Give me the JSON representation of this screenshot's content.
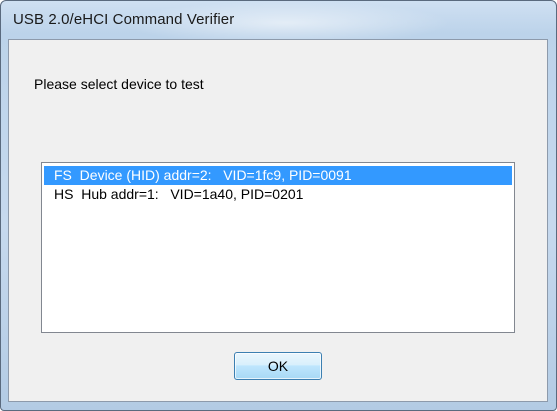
{
  "window": {
    "title": "USB 2.0/eHCI Command Verifier"
  },
  "dialog": {
    "prompt": "Please select device to test",
    "devices": [
      {
        "label": "FS  Device (HID) addr=2:   VID=1fc9, PID=0091",
        "selected": true
      },
      {
        "label": "HS  Hub addr=1:   VID=1a40, PID=0201",
        "selected": false
      }
    ],
    "ok_label": "OK"
  },
  "colors": {
    "selection": "#3399ff",
    "title_bar": "#c6d9ee"
  }
}
